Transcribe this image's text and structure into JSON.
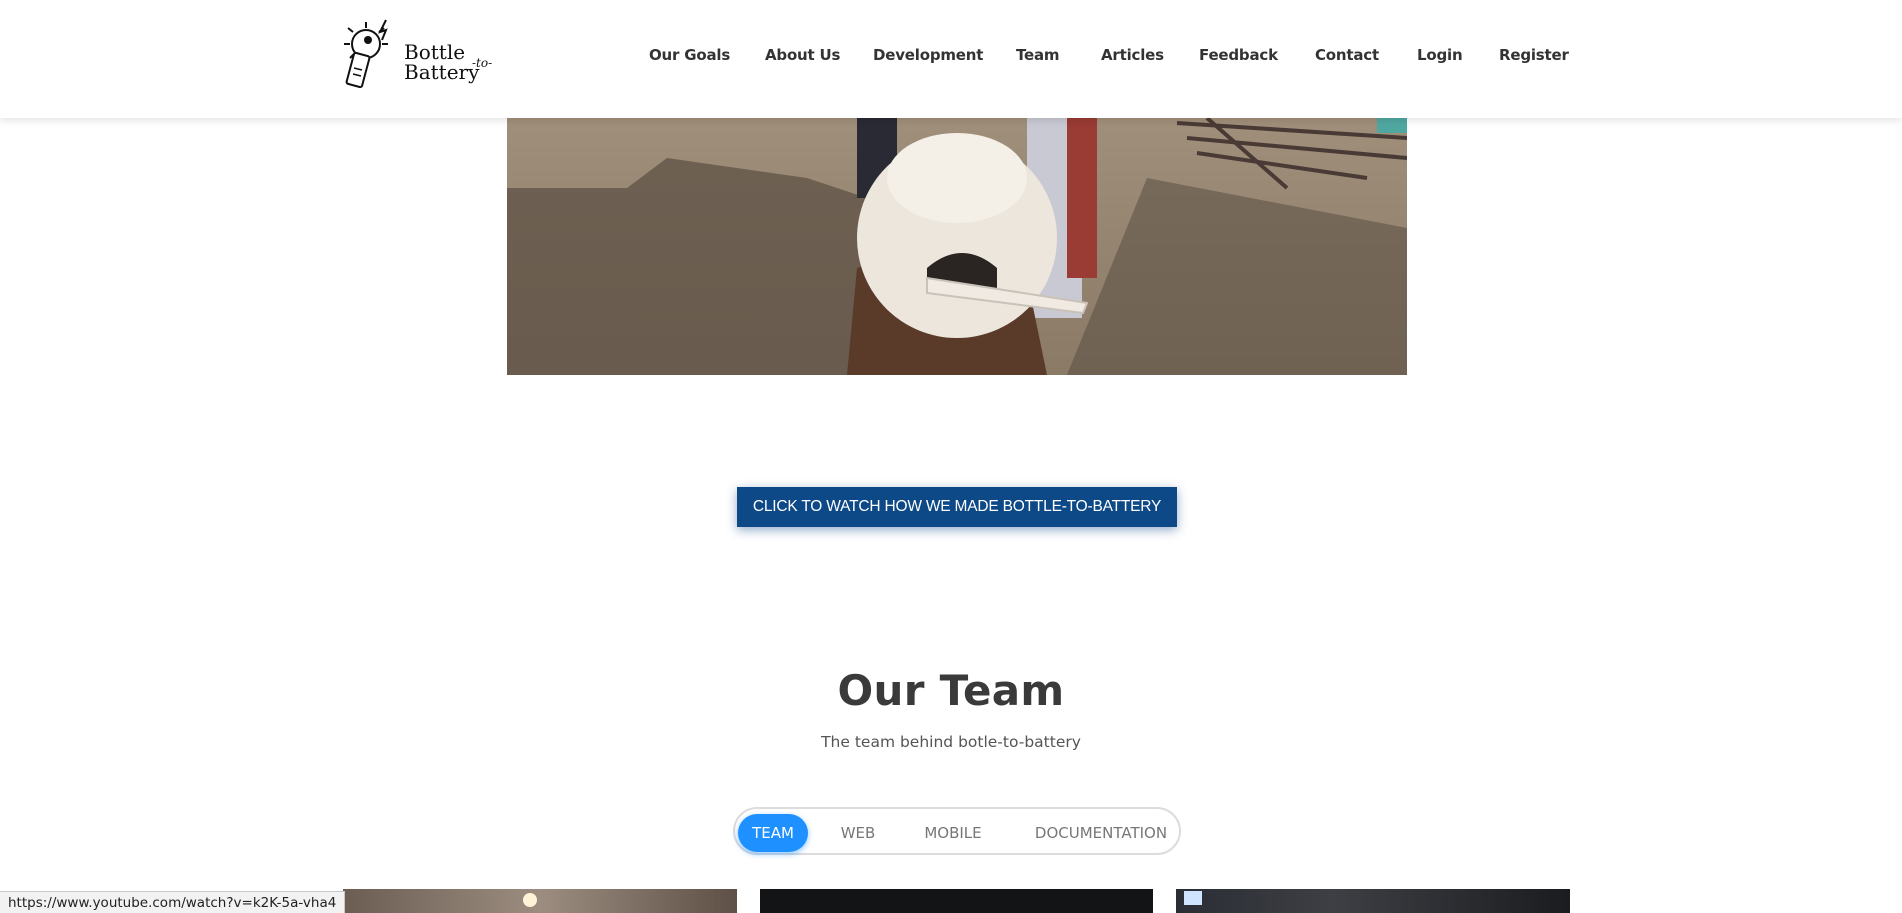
{
  "brand": {
    "line1": "Bottle",
    "line2": "Battery",
    "connector": "-to-"
  },
  "nav": {
    "items": [
      "Our Goals",
      "About Us",
      "Development",
      "Team",
      "Articles",
      "Feedback",
      "Contact",
      "Login",
      "Register"
    ]
  },
  "cta": {
    "label": "CLICK TO WATCH HOW WE MADE BOTTLE-TO-BATTERY"
  },
  "team": {
    "title": "Our Team",
    "subtitle": "The team behind botle-to-battery",
    "tabs": [
      "TEAM",
      "WEB",
      "MOBILE",
      "DOCUMENTATION"
    ],
    "active_tab": "TEAM"
  },
  "status_bar": {
    "url": "https://www.youtube.com/watch?v=k2K-5a-vha4"
  },
  "colors": {
    "cta_bg": "#0d4887",
    "tab_active": "#1e90ff",
    "heading": "#3a3a3a"
  }
}
